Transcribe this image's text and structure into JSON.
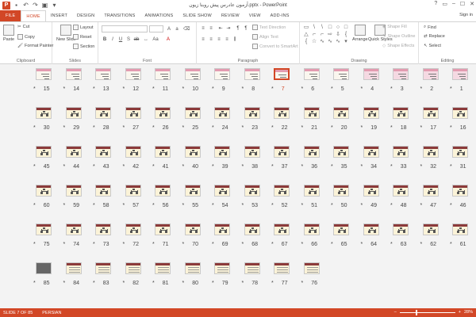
{
  "window": {
    "title": "آزمون عادرس پیش روبنا زیون.pptx - PowerPoint",
    "app_icon": "P",
    "controls": [
      "?",
      "▭",
      "–",
      "☐",
      "✕"
    ]
  },
  "tabs": [
    "FILE",
    "HOME",
    "INSERT",
    "DESIGN",
    "TRANSITIONS",
    "ANIMATIONS",
    "SLIDE SHOW",
    "REVIEW",
    "VIEW",
    "ADD-INS"
  ],
  "active_tab": "HOME",
  "sign_in": "Sign in",
  "ribbon": {
    "clipboard": {
      "name": "Clipboard",
      "paste": "Paste",
      "cut": "Cut",
      "copy": "Copy",
      "format_painter": "Format Painter"
    },
    "slides": {
      "name": "Slides",
      "new_slide": "New Slide",
      "layout": "Layout",
      "reset": "Reset",
      "section": "Section"
    },
    "font": {
      "name": "Font"
    },
    "paragraph": {
      "name": "Paragraph",
      "text_direction": "Text Direction",
      "align_text": "Align Text",
      "convert_smartart": "Convert to SmartArt"
    },
    "drawing": {
      "name": "Drawing",
      "arrange": "Arrange",
      "quick_styles": "Quick Styles",
      "shape_fill": "Shape Fill",
      "shape_outline": "Shape Outline",
      "shape_effects": "Shape Effects"
    },
    "editing": {
      "name": "Editing",
      "find": "Find",
      "replace": "Replace",
      "select": "Select"
    }
  },
  "slides": {
    "rows": [
      [
        15,
        14,
        13,
        12,
        11,
        10,
        9,
        8,
        7,
        6,
        5,
        4,
        3,
        2,
        1
      ],
      [
        30,
        29,
        28,
        27,
        26,
        25,
        24,
        23,
        22,
        21,
        20,
        19,
        18,
        17,
        16
      ],
      [
        45,
        44,
        43,
        42,
        41,
        40,
        39,
        38,
        37,
        36,
        35,
        34,
        33,
        32,
        31
      ],
      [
        60,
        59,
        58,
        57,
        56,
        55,
        54,
        53,
        52,
        51,
        50,
        49,
        48,
        47,
        46
      ],
      [
        75,
        74,
        73,
        72,
        71,
        70,
        69,
        68,
        67,
        66,
        65,
        64,
        63,
        62,
        61
      ],
      [
        85,
        84,
        83,
        82,
        81,
        80,
        79,
        78,
        77,
        76
      ]
    ],
    "selected": 7,
    "star": "*"
  },
  "status": {
    "slide_info": "SLIDE 7 OF 85",
    "language": "PERSIAN",
    "zoom": "28%",
    "zoom_fraction": 0.28
  },
  "colors": {
    "accent": "#d24726",
    "sorter_bg": "#f3f3f3"
  }
}
